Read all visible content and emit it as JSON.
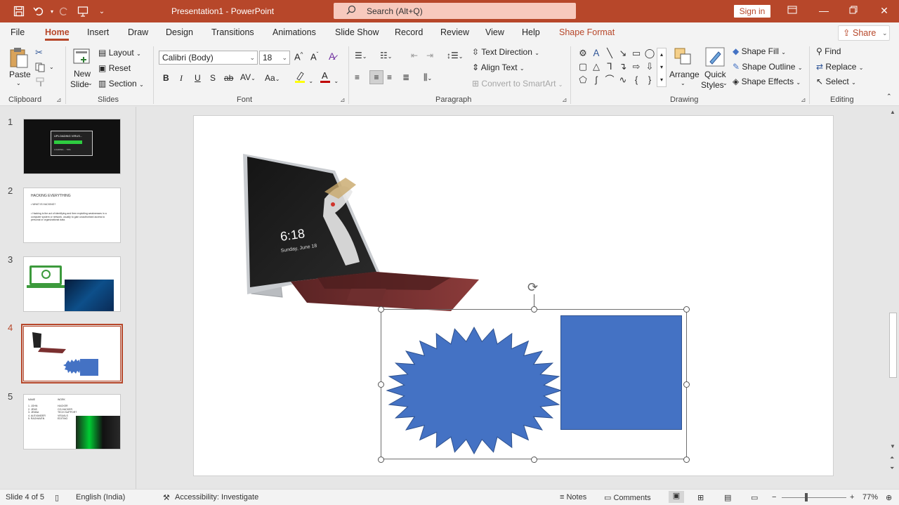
{
  "titlebar": {
    "doc_title": "Presentation1  -  PowerPoint",
    "search_placeholder": "Search (Alt+Q)",
    "signin_label": "Sign in"
  },
  "tabs": [
    "File",
    "Home",
    "Insert",
    "Draw",
    "Design",
    "Transitions",
    "Animations",
    "Slide Show",
    "Record",
    "Review",
    "View",
    "Help",
    "Shape Format"
  ],
  "share_label": "Share",
  "ribbon": {
    "clipboard": {
      "paste": "Paste",
      "label": "Clipboard"
    },
    "slides": {
      "new_slide_line1": "New",
      "new_slide_line2": "Slide",
      "layout": "Layout",
      "reset": "Reset",
      "section": "Section",
      "label": "Slides"
    },
    "font": {
      "font_name": "Calibri (Body)",
      "font_size": "18",
      "label": "Font",
      "bold": "B",
      "italic": "I",
      "underline": "U",
      "shadow": "S",
      "strike": "ab",
      "spacing": "AV",
      "case": "Aa"
    },
    "paragraph": {
      "text_direction": "Text Direction",
      "align_text": "Align Text",
      "convert_smartart": "Convert to SmartArt",
      "label": "Paragraph"
    },
    "drawing": {
      "arrange": "Arrange",
      "quick_styles_1": "Quick",
      "quick_styles_2": "Styles",
      "shape_fill": "Shape Fill",
      "shape_outline": "Shape Outline",
      "shape_effects": "Shape Effects",
      "label": "Drawing"
    },
    "editing": {
      "find": "Find",
      "replace": "Replace",
      "select": "Select",
      "label": "Editing"
    }
  },
  "slides": [
    {
      "number": "1",
      "thumb_title": "UPLOADING VIRUS...",
      "thumb_sub": "LOADING ... 70%"
    },
    {
      "number": "2",
      "thumb_title": "HACKING EVERYTHING",
      "thumb_bullet1": "• WHAT IS HACKING?",
      "thumb_bullet2": "• Hacking is the act of identifying and then exploiting weaknesses in a computer system or network, usually to gain unauthorised access to personal or organizational data."
    },
    {
      "number": "3"
    },
    {
      "number": "4"
    },
    {
      "number": "5",
      "col1": "NAME",
      "col2": "WORK",
      "rows": [
        "1. JOHN",
        "2. JENS",
        "3. JENNA",
        "4. ALEXANDER",
        "5. RAGHAVEN"
      ],
      "rows2": [
        "HACKER",
        "CO-HACKER",
        "TECH SUPPORT",
        "VISUALS",
        "EDITING"
      ]
    }
  ],
  "slide_main": {
    "device_time": "6:18",
    "device_date": "Sunday, June 18"
  },
  "status": {
    "slide_of": "Slide 4 of 5",
    "language": "English (India)",
    "accessibility": "Accessibility: Investigate",
    "notes": "Notes",
    "comments": "Comments",
    "zoom": "77%"
  },
  "colors": {
    "accent": "#b7472a",
    "shape_blue": "#4472c4"
  }
}
